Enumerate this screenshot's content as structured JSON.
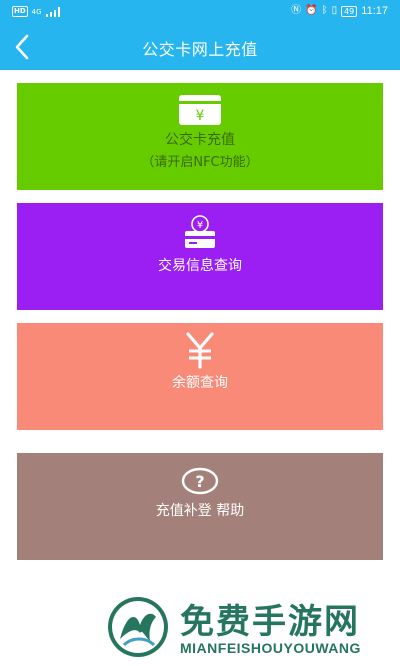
{
  "status_bar": {
    "network_badge": "HD",
    "signal_text": "4G",
    "battery": "49",
    "time": "11:17"
  },
  "header": {
    "title": "公交卡网上充值"
  },
  "tiles": [
    {
      "icon": "card-yuan-icon",
      "label": "公交卡充值",
      "sublabel": "（请开启NFC功能）",
      "color": "#66cc00"
    },
    {
      "icon": "card-coin-icon",
      "label": "交易信息查询",
      "color": "#9b1ff2"
    },
    {
      "icon": "yuan-icon",
      "label": "余额查询",
      "color": "#f98a77"
    },
    {
      "icon": "question-icon",
      "label": "充值补登 帮助",
      "color": "#a3817a"
    }
  ],
  "watermark": {
    "title": "免费手游网",
    "subtitle": "MIANFEISHOUYOUWANG",
    "logo_letter": "M"
  },
  "colors": {
    "header": "#27b5ef",
    "watermark": "#26755e"
  }
}
